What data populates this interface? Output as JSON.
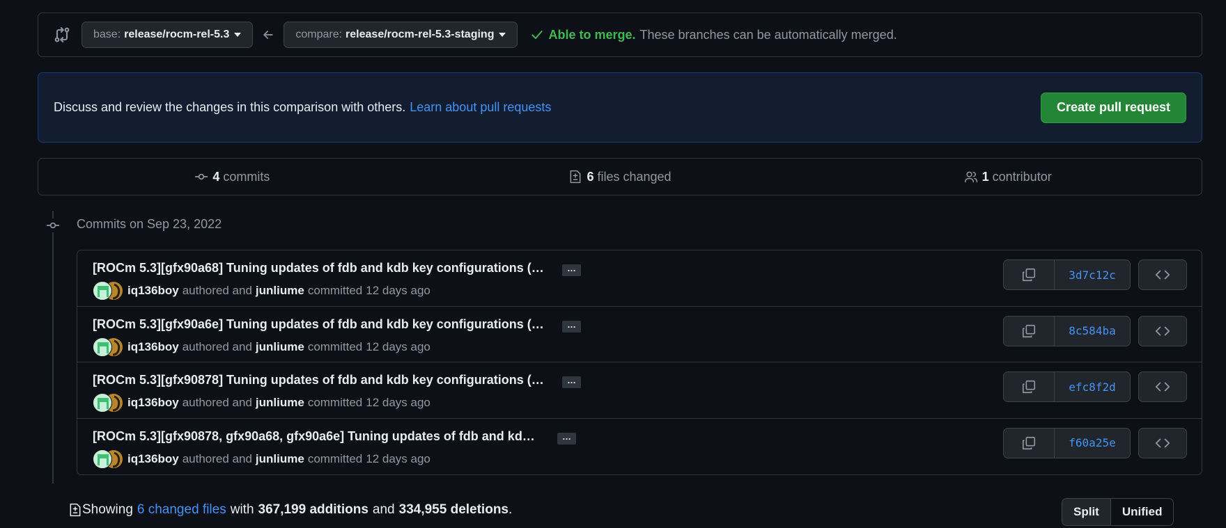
{
  "range": {
    "base_label": "base:",
    "base_value": "release/rocm-rel-5.3",
    "compare_label": "compare:",
    "compare_value": "release/rocm-rel-5.3-staging",
    "merge_ok": "Able to merge.",
    "merge_desc": "These branches can be automatically merged."
  },
  "flash": {
    "text": "Discuss and review the changes in this comparison with others.",
    "link": "Learn about pull requests",
    "button": "Create pull request"
  },
  "summary": {
    "commits_count": "4",
    "commits_label": "commits",
    "files_count": "6",
    "files_label": "files changed",
    "contributors_count": "1",
    "contributors_label": "contributor"
  },
  "timeline": {
    "date_heading": "Commits on Sep 23, 2022"
  },
  "commits": [
    {
      "title": "[ROCm 5.3][gfx90a68] Tuning updates of fdb and kdb key configurations (…",
      "author": "iq136boy",
      "authored": "authored and",
      "committer": "junliume",
      "committed": "committed",
      "time": "12 days ago",
      "sha": "3d7c12c",
      "ellipsis": "…"
    },
    {
      "title": "[ROCm 5.3][gfx90a6e] Tuning updates of fdb and kdb key configurations (…",
      "author": "iq136boy",
      "authored": "authored and",
      "committer": "junliume",
      "committed": "committed",
      "time": "12 days ago",
      "sha": "8c584ba",
      "ellipsis": "…"
    },
    {
      "title": "[ROCm 5.3][gfx90878] Tuning updates of fdb and kdb key configurations (…",
      "author": "iq136boy",
      "authored": "authored and",
      "committer": "junliume",
      "committed": "committed",
      "time": "12 days ago",
      "sha": "efc8f2d",
      "ellipsis": "…"
    },
    {
      "title": "[ROCm 5.3][gfx90878, gfx90a68, gfx90a6e] Tuning updates of fdb and kd…",
      "author": "iq136boy",
      "authored": "authored and",
      "committer": "junliume",
      "committed": "committed",
      "time": "12 days ago",
      "sha": "f60a25e",
      "ellipsis": "…"
    }
  ],
  "diffstat": {
    "showing": "Showing",
    "files_link": "6 changed files",
    "with": "with",
    "additions": "367,199 additions",
    "and": "and",
    "deletions": "334,955 deletions",
    "period": "."
  },
  "view": {
    "split": "Split",
    "unified": "Unified"
  },
  "colors": {
    "background": "#0d1117",
    "success": "#3fb950",
    "link": "#4493f8",
    "primary_button": "#238636"
  }
}
